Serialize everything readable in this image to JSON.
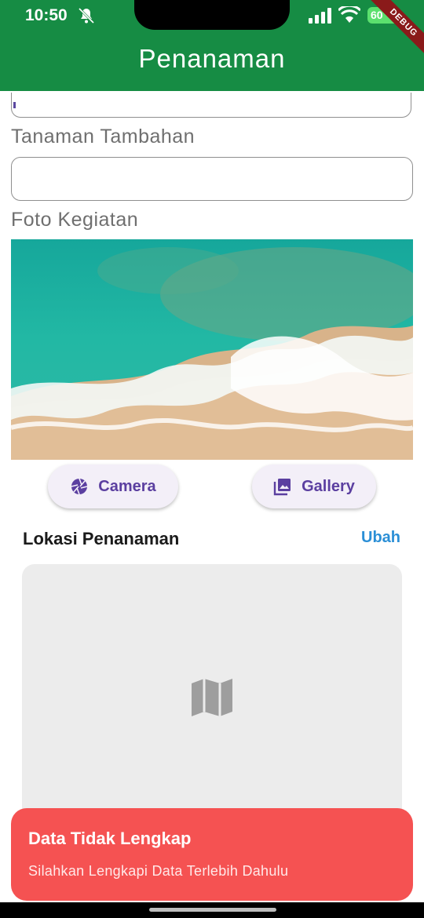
{
  "status_bar": {
    "time": "10:50",
    "battery": "60"
  },
  "debug_banner": "DEBUG",
  "app_bar": {
    "title": "Penanaman"
  },
  "form": {
    "tanaman_tambahan_label": "Tanaman Tambahan",
    "tanaman_tambahan_value": "",
    "foto_label": "Foto Kegiatan",
    "camera_label": "Camera",
    "gallery_label": "Gallery"
  },
  "lokasi": {
    "title": "Lokasi Penanaman",
    "edit_label": "Ubah"
  },
  "snackbar": {
    "title": "Data Tidak Lengkap",
    "message": "Silahkan Lengkapi Data Terlebih Dahulu"
  },
  "colors": {
    "app_bar": "#168c44",
    "accent": "#5b3fa0",
    "link": "#2b8fd6",
    "error": "#f55252"
  },
  "icons": [
    "bell-off-icon",
    "signal-icon",
    "wifi-icon",
    "battery-icon",
    "camera-icon",
    "gallery-icon",
    "map-icon"
  ]
}
